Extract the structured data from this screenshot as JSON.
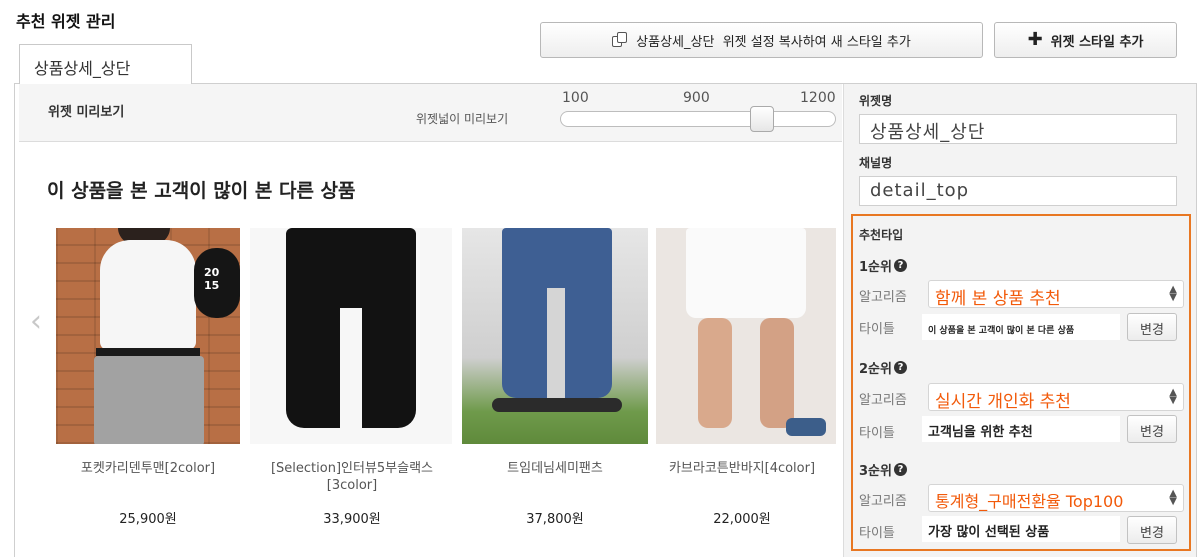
{
  "page_title": "추천 위젯 관리",
  "toolbar": {
    "copy_button_label": "상품상세_상단  위젯 설정 복사하여 새 스타일 추가",
    "copy_icon": "copy-icon",
    "add_button_label": "위젯 스타일 추가",
    "add_icon": "plus-icon"
  },
  "tabs": [
    {
      "label": "상품상세_상단"
    }
  ],
  "preview": {
    "label": "위젯 미리보기",
    "width_label": "위젯넓이 미리보기",
    "ticks": [
      "100",
      "900",
      "1200"
    ],
    "width_slider_value": 1050
  },
  "widget": {
    "heading": "이 상품을 본 고객이 많이 본 다른 상품",
    "prev_arrow": "‹",
    "products": [
      {
        "name": "포켓카리덴투맨[2color]",
        "price": "25,900원",
        "image": "product-photo-white-top-grey-pants"
      },
      {
        "name": "[Selection]인터뷰5부슬랙스[3color]",
        "price": "33,900원",
        "image": "product-photo-black-slacks"
      },
      {
        "name": "트임데님세미팬츠",
        "price": "37,800원",
        "image": "product-photo-ripped-jeans"
      },
      {
        "name": "카브라코튼반바지[4color]",
        "price": "22,000원",
        "image": "product-photo-white-shorts"
      }
    ]
  },
  "settings": {
    "widget_name_label": "위젯명",
    "widget_name_value": "상품상세_상단",
    "channel_name_label": "채널명",
    "channel_name_value": "detail_top",
    "rec_type_label": "추천타입",
    "algorithm_label": "알고리즘",
    "title_label": "타이틀",
    "change_label": "변경",
    "help_icon": "?",
    "accent_color": "#e87722",
    "algo_text_color": "#f25a0a",
    "ranks": [
      {
        "rank": "1순위",
        "algorithm": "함께 본 상품 추천",
        "title": "이 상품을 본 고객이 많이 본 다른 상품"
      },
      {
        "rank": "2순위",
        "algorithm": "실시간 개인화 추천",
        "title": "고객님을 위한 추천"
      },
      {
        "rank": "3순위",
        "algorithm": "통계형_구매전환율 Top100",
        "title": "가장 많이 선택된 상품"
      }
    ]
  }
}
